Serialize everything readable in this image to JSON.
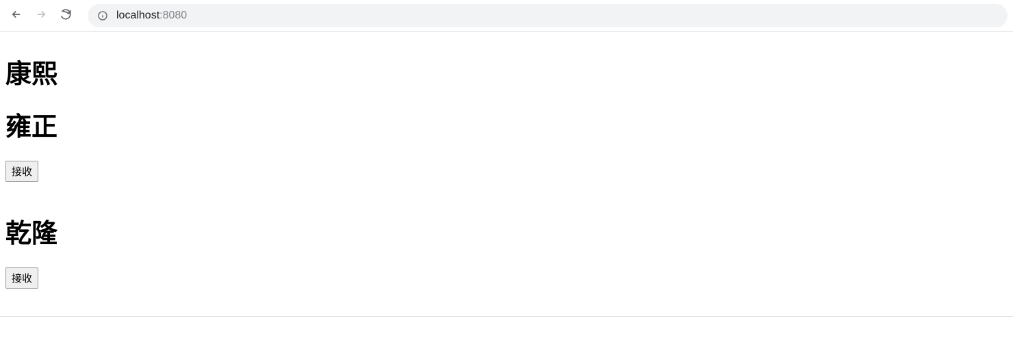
{
  "addressBar": {
    "host": "localhost",
    "port": ":8080"
  },
  "content": {
    "heading1": "康熙",
    "heading2": "雍正",
    "button1": "接收",
    "heading3": "乾隆",
    "button2": "接收"
  }
}
